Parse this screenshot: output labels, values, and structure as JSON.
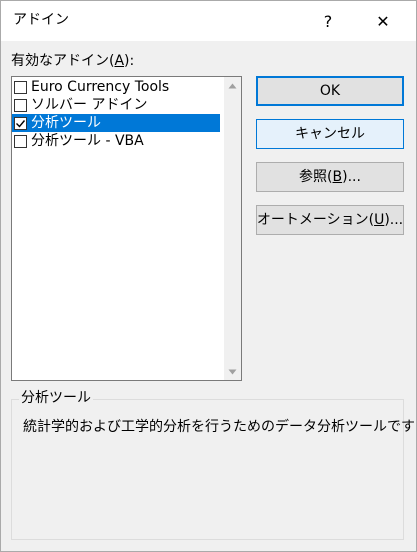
{
  "dialog": {
    "title": "アドイン",
    "help_label": "?",
    "close_label": "✕"
  },
  "addins": {
    "label_prefix": "有効なアドイン(",
    "label_key": "A",
    "label_suffix": "):",
    "items": [
      {
        "label": "Euro Currency Tools",
        "checked": false,
        "selected": false
      },
      {
        "label": "ソルバー アドイン",
        "checked": false,
        "selected": false
      },
      {
        "label": "分析ツール",
        "checked": true,
        "selected": true
      },
      {
        "label": "分析ツール - VBA",
        "checked": false,
        "selected": false
      }
    ]
  },
  "buttons": {
    "ok": "OK",
    "cancel": "キャンセル",
    "browse_prefix": "参照(",
    "browse_key": "B",
    "browse_suffix": ")...",
    "automation_prefix": "オートメーション(",
    "automation_key": "U",
    "automation_suffix": ")..."
  },
  "details": {
    "title": "分析ツール",
    "description": "統計学的および工学的分析を行うためのデータ分析ツールです"
  },
  "colors": {
    "selection": "#0078d7",
    "focus_border": "#0078d7",
    "focus_background": "#e5f1fb"
  },
  "icons": {
    "checkmark": "check-icon",
    "scroll_up": "triangle-up-icon",
    "scroll_down": "triangle-down-icon"
  }
}
